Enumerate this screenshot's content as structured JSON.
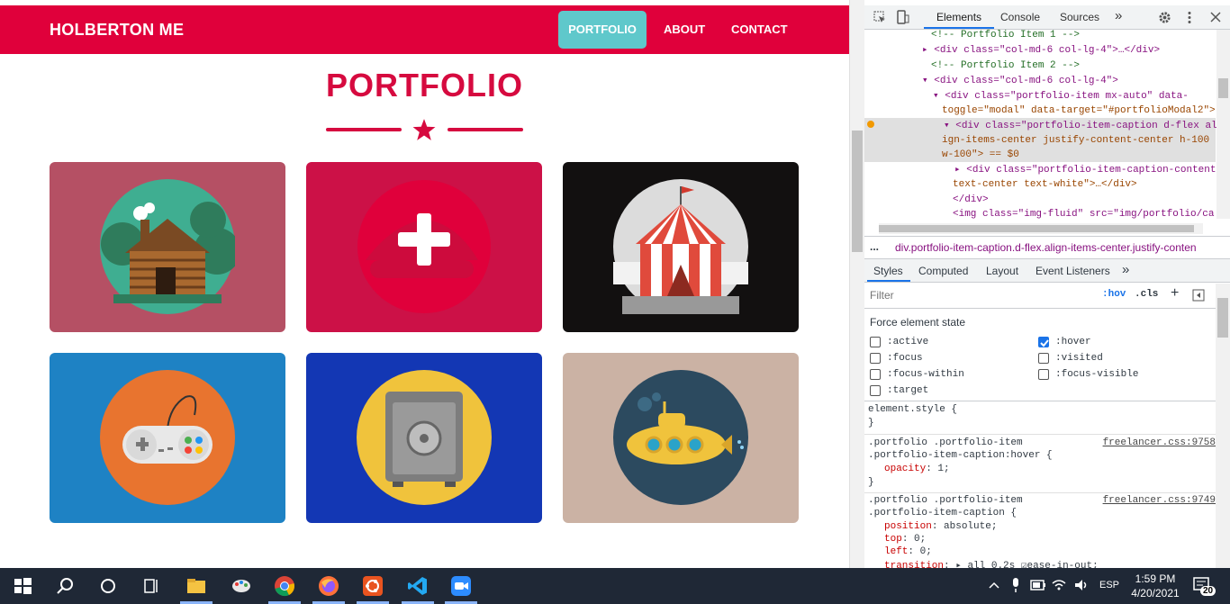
{
  "site": {
    "brand": "HOLBERTON ME",
    "nav": [
      {
        "label": "PORTFOLIO",
        "active": true
      },
      {
        "label": "ABOUT"
      },
      {
        "label": "CONTACT"
      }
    ],
    "title": "PORTFOLIO",
    "colors": {
      "primary": "#e0003b",
      "accent": "#5fc8cb"
    },
    "cards": [
      {
        "name": "cabin",
        "bg": "#b55064"
      },
      {
        "name": "cake",
        "bg": "#cc1147"
      },
      {
        "name": "circus",
        "bg": "#121010"
      },
      {
        "name": "game",
        "bg": "#1e82c4"
      },
      {
        "name": "safe",
        "bg": "#1337b4"
      },
      {
        "name": "submarine",
        "bg": "#cbb2a4"
      }
    ]
  },
  "devtools": {
    "tabs": [
      "Elements",
      "Console",
      "Sources"
    ],
    "more": "»",
    "dom": [
      "<!-- Portfolio Item 1 -->",
      "<div class=\"col-md-6 col-lg-4\">…</div>",
      "<!-- Portfolio Item 2 -->",
      "<div class=\"col-md-6 col-lg-4\">",
      "<div class=\"portfolio-item mx-auto\" data-",
      "toggle=\"modal\" data-target=\"#portfolioModal2\">",
      "<div class=\"portfolio-item-caption d-flex al",
      "ign-items-center justify-content-center h-100",
      "w-100\"> == $0",
      "<div class=\"portfolio-item-caption-content",
      "text-center text-white\">…</div>",
      "</div>",
      "<img class=\"img-fluid\" src=\"img/portfolio/ca"
    ],
    "breadcrumb": "div.portfolio-item-caption.d-flex.align-items-center.justify-conten",
    "breadcrumb_more": "...",
    "style_tabs": [
      "Styles",
      "Computed",
      "Layout",
      "Event Listeners"
    ],
    "filter_placeholder": "Filter",
    "hov": ":hov",
    "cls": ".cls",
    "force_title": "Force element state",
    "states": [
      {
        "label": ":active",
        "checked": false
      },
      {
        "label": ":hover",
        "checked": true
      },
      {
        "label": ":focus",
        "checked": false
      },
      {
        "label": ":visited",
        "checked": false
      },
      {
        "label": ":focus-within",
        "checked": false
      },
      {
        "label": ":focus-visible",
        "checked": false
      },
      {
        "label": ":target",
        "checked": false
      }
    ],
    "rules": [
      {
        "selector": [
          "element.style {"
        ],
        "props": [],
        "close": "}",
        "source": ""
      },
      {
        "selector": [
          ".portfolio .portfolio-item",
          ".portfolio-item-caption:hover {"
        ],
        "props": [
          {
            "k": "opacity",
            "v": "1;"
          }
        ],
        "close": "}",
        "source": "freelancer.css:9758"
      },
      {
        "selector": [
          ".portfolio .portfolio-item",
          ".portfolio-item-caption {"
        ],
        "props": [
          {
            "k": "position",
            "v": "absolute;"
          },
          {
            "k": "top",
            "v": "0;"
          },
          {
            "k": "left",
            "v": "0;"
          },
          {
            "k": "transition",
            "v": "▸ all 0.2s ☑ease-in-out;"
          }
        ],
        "close": "",
        "source": "freelancer.css:9749"
      }
    ]
  },
  "taskbar": {
    "apps": [
      "start-icon",
      "search-icon",
      "cortana-icon",
      "task-view-icon",
      "file-explorer-icon",
      "paint-icon",
      "chrome-icon",
      "firefox-icon",
      "ubuntu-icon",
      "vscode-icon",
      "zoom-icon"
    ],
    "lang": "ESP",
    "time": "1:59 PM",
    "date": "4/20/2021",
    "notifications": "20"
  }
}
